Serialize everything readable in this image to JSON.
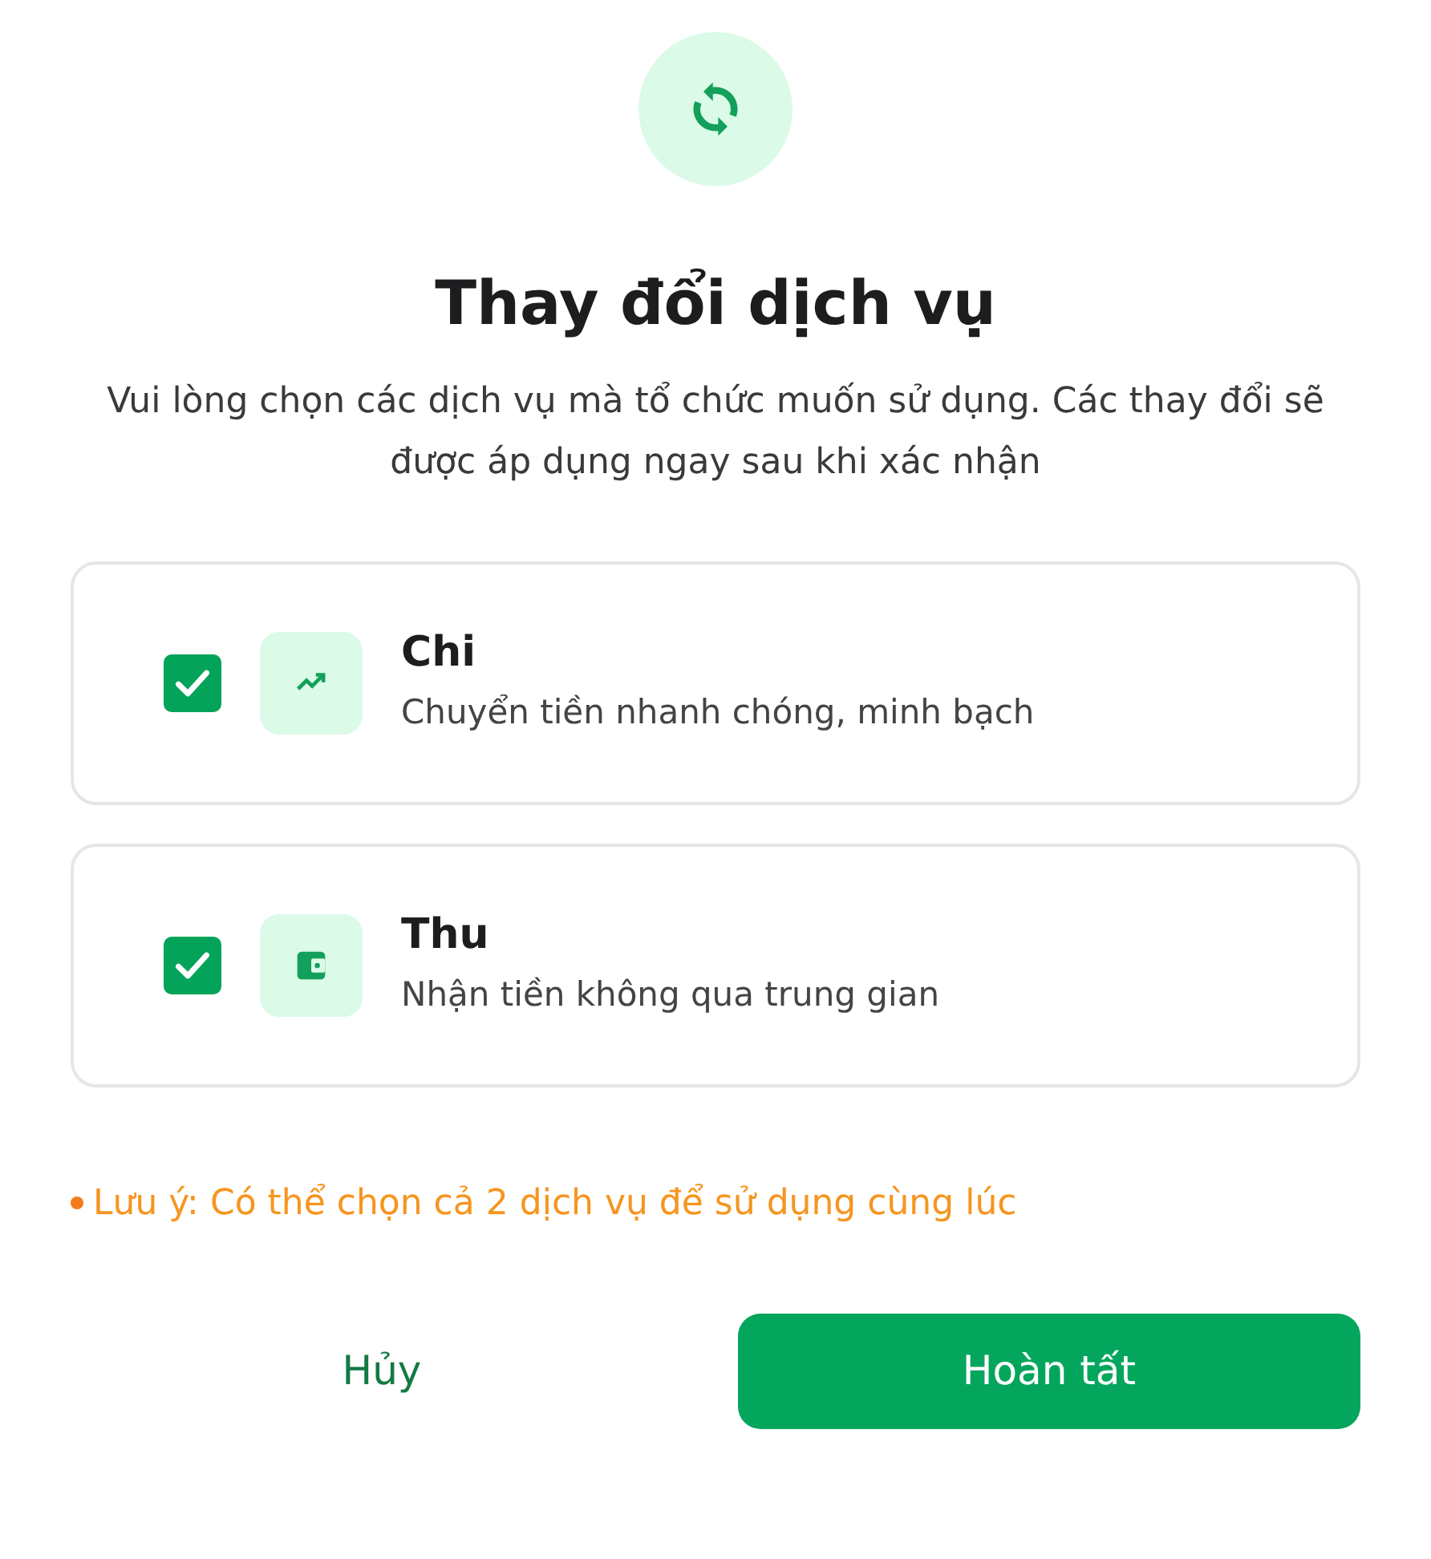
{
  "dialog": {
    "title": "Thay đổi dịch vụ",
    "description": "Vui lòng chọn các dịch vụ mà tổ chức muốn sử dụng. Các thay đổi sẽ được áp dụng ngay sau khi xác nhận"
  },
  "services": [
    {
      "kind": "trend",
      "name": "Chi",
      "description": "Chuyển tiền nhanh chóng, minh bạch",
      "checked": true
    },
    {
      "kind": "wallet",
      "name": "Thu",
      "description": "Nhận tiền không qua trung gian",
      "checked": true
    }
  ],
  "note": "Lưu ý: Có thể chọn cả 2 dịch vụ để sử dụng cùng lúc",
  "buttons": {
    "cancel": "Hủy",
    "confirm": "Hoàn tất"
  }
}
